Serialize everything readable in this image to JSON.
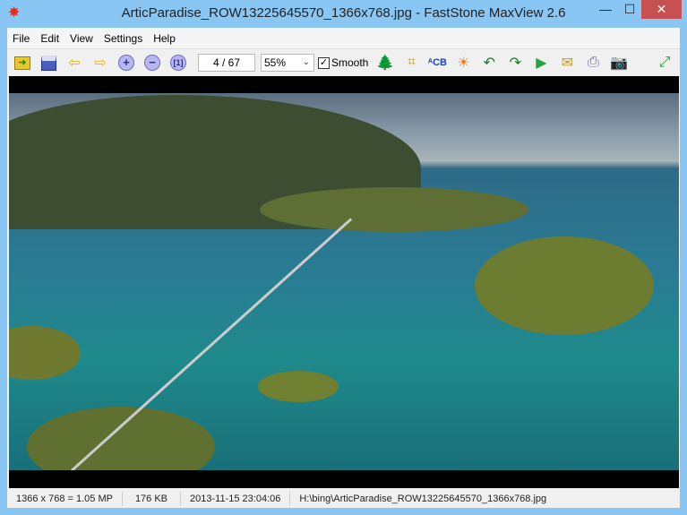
{
  "window": {
    "title": "ArticParadise_ROW13225645570_1366x768.jpg - FastStone MaxView 2.6",
    "minimize": "—",
    "maximize": "☐",
    "close": "✕"
  },
  "menu": [
    "File",
    "Edit",
    "View",
    "Settings",
    "Help"
  ],
  "toolbar": {
    "page": "4 / 67",
    "zoom": "55%",
    "smooth_label": "Smooth",
    "smooth_checked": true,
    "icons": [
      "open-folder",
      "save",
      "previous-arrow",
      "next-arrow",
      "zoom-in",
      "zoom-out",
      "actual-size",
      "resize",
      "crop",
      "text",
      "brightness",
      "rotate-left-90",
      "rotate-right-90",
      "slideshow",
      "email",
      "print",
      "capture",
      "fullscreen"
    ]
  },
  "status": {
    "dimensions": "1366 x 768 = 1.05 MP",
    "size": "176 KB",
    "date": "2013-11-15 23:04:06",
    "path": "H:\\bing\\ArticParadise_ROW13225645570_1366x768.jpg"
  },
  "colors": {
    "frame": "#8ac6f4",
    "close": "#c75050"
  }
}
